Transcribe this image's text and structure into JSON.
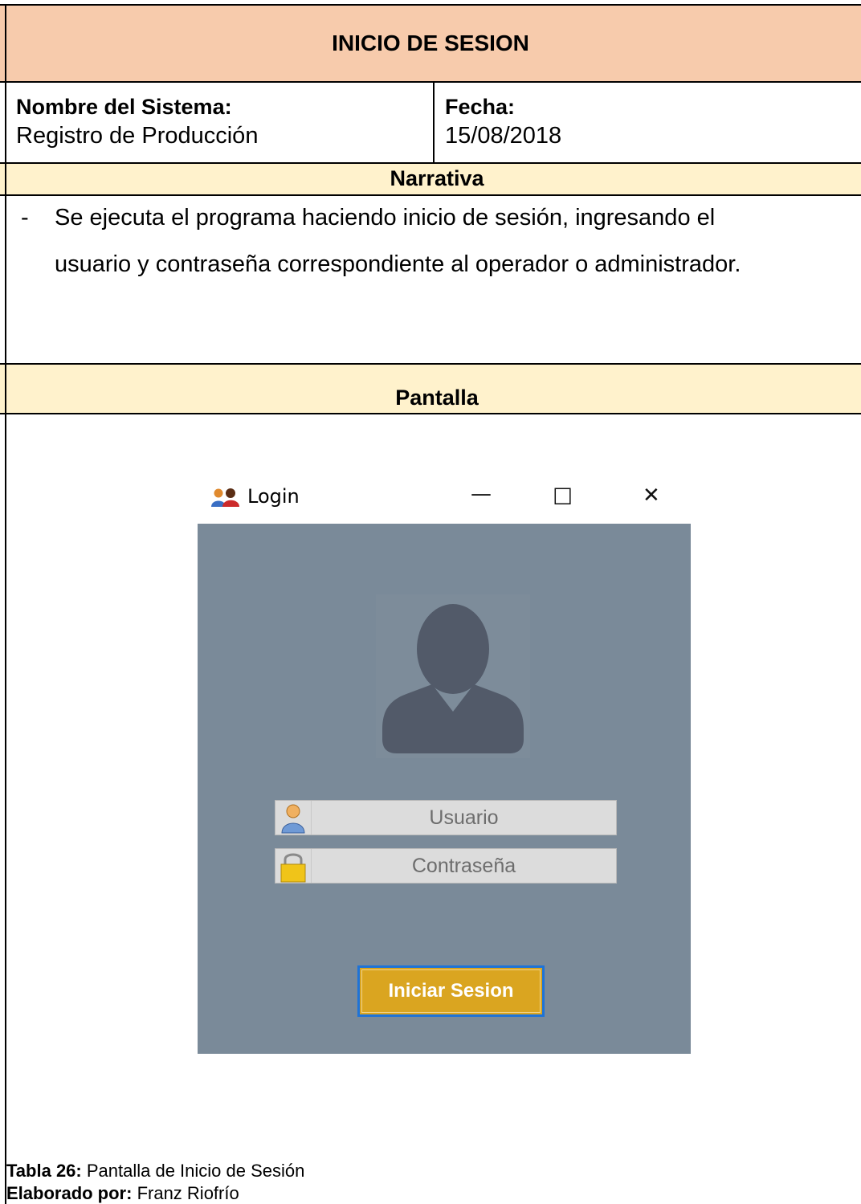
{
  "header": {
    "title": "INICIO DE SESION"
  },
  "system": {
    "label": "Nombre del Sistema:",
    "value": "Registro de Producción"
  },
  "date": {
    "label": "Fecha:",
    "value": "15/08/2018"
  },
  "narrative": {
    "heading": "Narrativa",
    "bullet": "-",
    "line1": "Se ejecuta el programa haciendo inicio de sesión, ingresando el",
    "line2": "usuario y contraseña correspondiente al operador o administrador."
  },
  "screen": {
    "heading": "Pantalla",
    "window": {
      "title": "Login",
      "minimize": "—",
      "maximize": "☐",
      "close": "✕",
      "username_placeholder": "Usuario",
      "password_placeholder": "Contraseña",
      "submit_label": "Iniciar Sesion"
    }
  },
  "caption": {
    "table_label": "Tabla 26:",
    "table_text": " Pantalla de Inicio de Sesión",
    "author_label": "Elaborado por:",
    "author_text": " Franz Riofrío"
  },
  "colors": {
    "title_band": "#f7cbac",
    "section_band": "#fff2cc",
    "window_body": "#7a8a99",
    "button": "#daa520",
    "button_border": "#1e73d8"
  }
}
